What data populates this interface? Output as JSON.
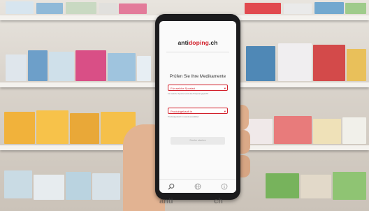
{
  "app": {
    "logo_prefix": "anti",
    "logo_brand": "doping",
    "logo_suffix": ".ch"
  },
  "main": {
    "heading": "Prüfen Sie Ihre Medikamente",
    "select_1": {
      "value": "Für welche Sportart ...",
      "hint": "Für welche Sportart wird das Präparat geprüft?"
    },
    "select_2": {
      "value": "Produktgekauft in ...",
      "hint": "Produktgekauft in (Land) auswählen"
    },
    "submit_label": "Suche starten"
  },
  "tabbar": {
    "icons": [
      "search-icon",
      "globe-icon",
      "info-icon"
    ]
  },
  "watermark": {
    "left": "anti",
    "right": "ch"
  },
  "colors": {
    "brand_red": "#d21f2a",
    "phone_body": "#1b1b1d",
    "screen_bg": "#fafafa"
  }
}
